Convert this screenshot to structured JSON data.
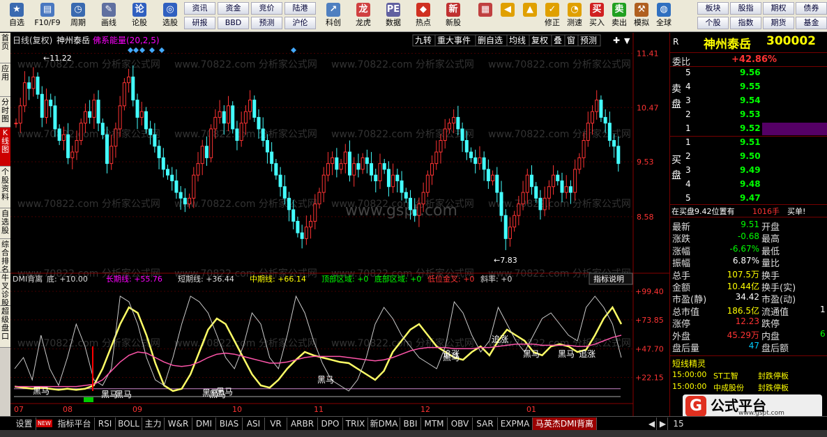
{
  "toolbar": {
    "buttons": [
      {
        "label": "自选",
        "icon": "star-icon",
        "color": "#3a6ab0"
      },
      {
        "label": "F10/F9",
        "icon": "document-icon",
        "color": "#4a78c0"
      },
      {
        "label": "周期",
        "icon": "clock-icon",
        "color": "#3a6ab0"
      },
      {
        "label": "画线",
        "icon": "pencil-icon",
        "color": "#6070a0"
      },
      {
        "label": "论股",
        "icon": "discuss-icon",
        "color": "#3060c0"
      },
      {
        "label": "选股",
        "icon": "select-icon",
        "color": "#3060c0"
      }
    ],
    "grid_top": [
      "资讯",
      "资金",
      "竞价",
      "陆港"
    ],
    "grid_bottom": [
      "研报",
      "BBD",
      "预测",
      "沪伦"
    ],
    "buttons2": [
      {
        "label": "科创",
        "icon": "chart-icon",
        "color": "#5080c0"
      },
      {
        "label": "龙虎",
        "icon": "dragon-icon",
        "color": "#d04040"
      },
      {
        "label": "数据",
        "icon": "pe-icon",
        "color": "#6060a0"
      },
      {
        "label": "热点",
        "icon": "hot-icon",
        "color": "#d03020"
      },
      {
        "label": "新股",
        "icon": "ipo-icon",
        "color": "#c03030"
      }
    ],
    "buttons3": [
      {
        "label": "",
        "icon": "grid-icon",
        "color": "#c04040"
      },
      {
        "label": "",
        "icon": "back-arrow-icon",
        "color": "#e0a000"
      },
      {
        "label": "",
        "icon": "up-arrow-icon",
        "color": "#e0a000"
      },
      {
        "label": "修正",
        "icon": "check-icon",
        "color": "#e0a000"
      },
      {
        "label": "测速",
        "icon": "speed-icon",
        "color": "#e0a000"
      },
      {
        "label": "买入",
        "icon": "buy-icon",
        "color": "#d02020"
      },
      {
        "label": "卖出",
        "icon": "sell-icon",
        "color": "#20a020"
      },
      {
        "label": "模拟",
        "icon": "hammer-icon",
        "color": "#b06020"
      },
      {
        "label": "全球",
        "icon": "globe-icon",
        "color": "#3070c0"
      }
    ],
    "grid2_top": [
      "板块",
      "股指",
      "期权",
      "债券"
    ],
    "grid2_bottom": [
      "个股",
      "指数",
      "期货",
      "基金"
    ]
  },
  "side_tabs": [
    "首页",
    "应用",
    "分时图",
    "K线图",
    "个股资料",
    "自选股",
    "综合排名",
    "牛叉诊股",
    "超级盘口"
  ],
  "kchart": {
    "title": "日线(复权)",
    "stock": "神州泰岳",
    "indicator": "佛系能量(20,2,5)",
    "menu": [
      "九转",
      "重大事件",
      "删自选",
      "均线",
      "复权",
      "叠",
      "窗",
      "预测"
    ],
    "price_labels": [
      "11.41",
      "10.47",
      "9.53",
      "8.58"
    ],
    "high_label": "11.22",
    "low_label": "7.83",
    "watermark": "www.gspt.com",
    "repeat_watermark": "www.70822.com 分析家公式网"
  },
  "dmi": {
    "name": "DMI背离",
    "di": "底: +10.00",
    "long": "长期线: +55.76",
    "short": "短期线: +36.44",
    "mid": "中期线: +66.14",
    "top_zone": "顶部区域: +0",
    "bottom_zone": "底部区域: +0",
    "low_cross": "低位金叉: +0",
    "slope": "斜率: +0",
    "explain_btn": "指标说明",
    "axis_labels": [
      "+99.40",
      "+73.85",
      "+47.70",
      "+22.15"
    ],
    "signals": [
      "黑马",
      "黑马",
      "黑马",
      "黑马",
      "黑马",
      "黑马",
      "黑马",
      "追涨",
      "黑马",
      "追涨",
      "追涨",
      "黑马",
      "黑马"
    ],
    "months": [
      "07",
      "08",
      "09",
      "10",
      "11",
      "12",
      "01"
    ]
  },
  "right": {
    "r_label": "R",
    "stock_name": "神州泰岳",
    "code": "300002",
    "weibi_label": "委比",
    "weibi": "+42.86%",
    "sell_label": "卖盘",
    "buy_label": "买盘",
    "sells": [
      {
        "n": "5",
        "p": "9.56"
      },
      {
        "n": "4",
        "p": "9.55"
      },
      {
        "n": "3",
        "p": "9.54"
      },
      {
        "n": "2",
        "p": "9.53"
      },
      {
        "n": "1",
        "p": "9.52"
      }
    ],
    "buys": [
      {
        "n": "1",
        "p": "9.51"
      },
      {
        "n": "2",
        "p": "9.50"
      },
      {
        "n": "3",
        "p": "9.49"
      },
      {
        "n": "4",
        "p": "9.48"
      },
      {
        "n": "5",
        "p": "9.47"
      }
    ],
    "inbuy": "在买盘9.42位置有",
    "inbuy_vol": "1016手",
    "inbuy_tag": "买单!",
    "stats": [
      {
        "l": "最新",
        "v": "9.51",
        "l2": "开盘",
        "c": "#0f0"
      },
      {
        "l": "涨跌",
        "v": "-0.68",
        "l2": "最高",
        "c": "#0f0"
      },
      {
        "l": "涨幅",
        "v": "-6.67%",
        "l2": "最低",
        "c": "#0f0"
      },
      {
        "l": "振幅",
        "v": "6.87%",
        "l2": "量比",
        "c": "#fff"
      },
      {
        "l": "总手",
        "v": "107.5万",
        "l2": "换手",
        "c": "#ff0"
      },
      {
        "l": "金额",
        "v": "10.44亿",
        "l2": "换手(实)",
        "c": "#ff0"
      },
      {
        "l": "市盈(静)",
        "v": "34.42",
        "l2": "市盈(动)",
        "c": "#fff"
      },
      {
        "l": "总市值",
        "v": "186.5亿",
        "l2": "流通值",
        "c": "#ff0"
      },
      {
        "l": "涨停",
        "v": "12.23",
        "l2": "跌停",
        "c": "#f33"
      },
      {
        "l": "外盘",
        "v": "45.29万",
        "l2": "内盘",
        "c": "#f33"
      },
      {
        "l": "盘后量",
        "v": "47",
        "l2": "盘后额",
        "c": "#0cf"
      }
    ],
    "right_edge": [
      "1",
      "6"
    ],
    "short_title": "短线精灵",
    "news": [
      {
        "t": "15:00:00",
        "s": "ST工智",
        "e": "封跌停板"
      },
      {
        "t": "15:00:00",
        "s": "中成股份",
        "e": "封跌停板"
      }
    ],
    "logo": "公式平台",
    "logo_url": "www.gspt.com"
  },
  "bottom_tabs": [
    "设置",
    "指标平台",
    "RSI",
    "BOLL",
    "主力",
    "W&R",
    "DMI",
    "BIAS",
    "ASI",
    "VR",
    "ARBR",
    "DPO",
    "TRIX",
    "新DMA",
    "BBI",
    "MTM",
    "OBV",
    "SAR",
    "EXPMA",
    "马英杰DMI背离"
  ],
  "bottom_new": "NEW",
  "bottom_num": "15"
}
